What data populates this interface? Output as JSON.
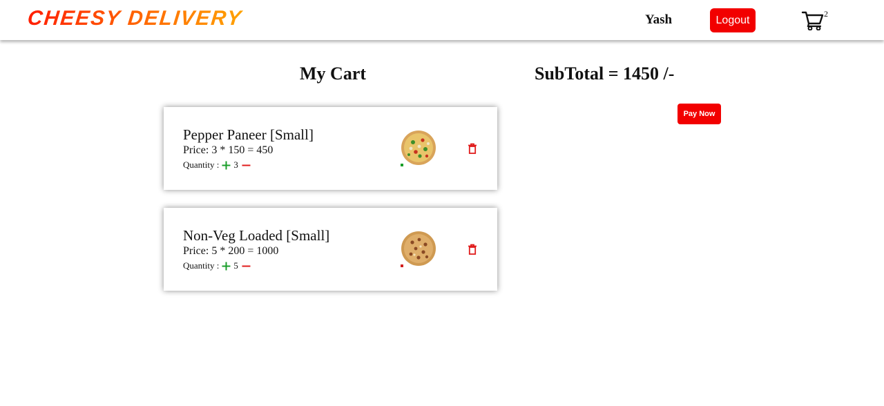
{
  "header": {
    "brand": "CHEESY DELIVERY",
    "username": "Yash",
    "logout_label": "Logout",
    "cart_count": "2",
    "cart_icon": "cart-icon"
  },
  "cart": {
    "title": "My Cart",
    "subtotal": "SubTotal = 1450 /-",
    "pay_label": "Pay Now",
    "qty_label": "Quantity :",
    "items": [
      {
        "name": "Pepper Paneer [Small]",
        "price": "Price: 3 * 150 = 450",
        "quantity": "3",
        "type_icon": "veg-indicator-icon",
        "type_color": "#1a9e2a"
      },
      {
        "name": "Non-Veg Loaded [Small]",
        "price": "Price: 5 * 200 = 1000",
        "quantity": "5",
        "type_icon": "non-veg-indicator-icon",
        "type_color": "#d21f1f"
      }
    ]
  },
  "colors": {
    "accent_red": "#f20000",
    "plus_green": "#1a9e2a",
    "minus_red": "#e01b1b",
    "brand_gradient_start": "#ff1e00",
    "brand_gradient_end": "#ffa200"
  }
}
